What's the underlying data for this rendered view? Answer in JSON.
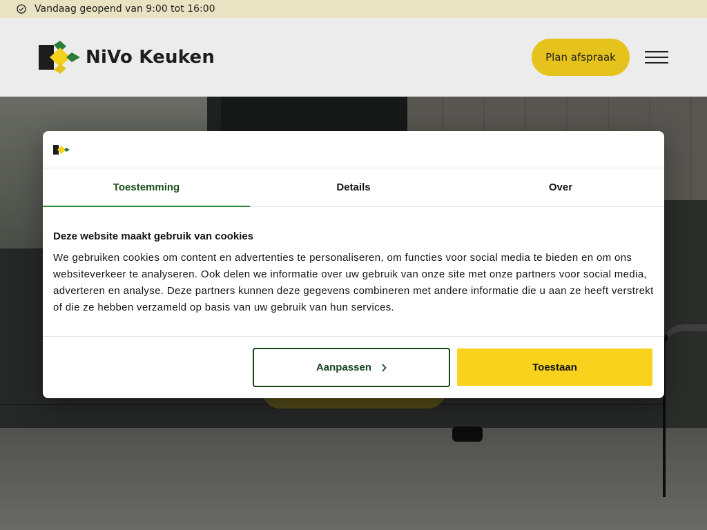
{
  "topbar": {
    "status_text": "Vandaag geopend van 9:00 tot 16:00",
    "icon": "check-circle-icon"
  },
  "header": {
    "brand_name": "NiVo Keuken",
    "plan_button": "Plan afspraak",
    "menu_icon": "hamburger-menu-icon"
  },
  "cookie_dialog": {
    "tabs": [
      {
        "label": "Toestemming",
        "active": true
      },
      {
        "label": "Details",
        "active": false
      },
      {
        "label": "Over",
        "active": false
      }
    ],
    "title": "Deze website maakt gebruik van cookies",
    "body": "We gebruiken cookies om content en advertenties te personaliseren, om functies voor social media te bieden en om ons websiteverkeer te analyseren. Ook delen we informatie over uw gebruik van onze site met onze partners voor social media, adverteren en analyse. Deze partners kunnen deze gegevens combineren met andere informatie die u aan ze heeft verstrekt of die ze hebben verzameld op basis van uw gebruik van hun services.",
    "customize_button": "Aanpassen",
    "allow_button": "Toestaan"
  },
  "colors": {
    "accent_yellow": "#f9d21e",
    "accent_green": "#14451a",
    "tab_underline": "#2f8a36"
  }
}
